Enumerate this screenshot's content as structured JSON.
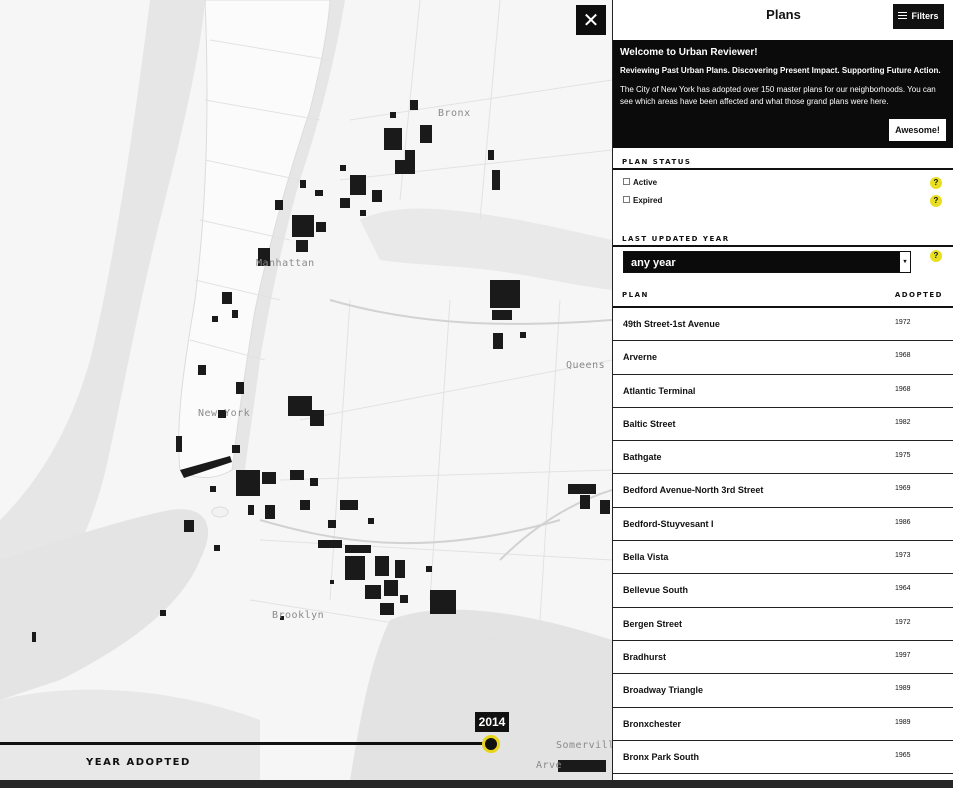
{
  "map": {
    "close_label": "✕",
    "labels": {
      "bronx": "Bronx",
      "manhattan": "Manhattan",
      "new_york": "New York",
      "queens": "Queens",
      "brooklyn": "Brooklyn",
      "somerville": "Somerville",
      "arverne": "Arve"
    },
    "timeline": {
      "year": "2014",
      "label": "YEAR ADOPTED"
    }
  },
  "panel": {
    "title": "Plans",
    "filters_label": "Filters",
    "welcome": {
      "heading": "Welcome to Urban Reviewer!",
      "subheading": "Reviewing Past Urban Plans. Discovering Present Impact. Supporting Future Action.",
      "body": "The City of New York has adopted over 150 master plans for our neighborhoods. You can see which areas have been affected and what those grand plans were here.",
      "button": "Awesome!"
    },
    "plan_status": {
      "label": "PLAN STATUS",
      "options": [
        {
          "label": "Active",
          "checked": false
        },
        {
          "label": "Expired",
          "checked": false
        }
      ],
      "help": "?"
    },
    "last_updated": {
      "label": "LAST UPDATED YEAR",
      "selected": "any year",
      "help": "?"
    },
    "table": {
      "col_plan": "PLAN",
      "col_adopted": "ADOPTED",
      "rows": [
        {
          "name": "49th Street-1st Avenue",
          "year": "1972"
        },
        {
          "name": "Arverne",
          "year": "1968"
        },
        {
          "name": "Atlantic Terminal",
          "year": "1968"
        },
        {
          "name": "Baltic Street",
          "year": "1982"
        },
        {
          "name": "Bathgate",
          "year": "1975"
        },
        {
          "name": "Bedford Avenue-North 3rd Street",
          "year": "1969"
        },
        {
          "name": "Bedford-Stuyvesant I",
          "year": "1986"
        },
        {
          "name": "Bella Vista",
          "year": "1973"
        },
        {
          "name": "Bellevue South",
          "year": "1964"
        },
        {
          "name": "Bergen Street",
          "year": "1972"
        },
        {
          "name": "Bradhurst",
          "year": "1997"
        },
        {
          "name": "Broadway Triangle",
          "year": "1989"
        },
        {
          "name": "Bronxchester",
          "year": "1989"
        },
        {
          "name": "Bronx Park South",
          "year": "1965"
        }
      ]
    }
  }
}
